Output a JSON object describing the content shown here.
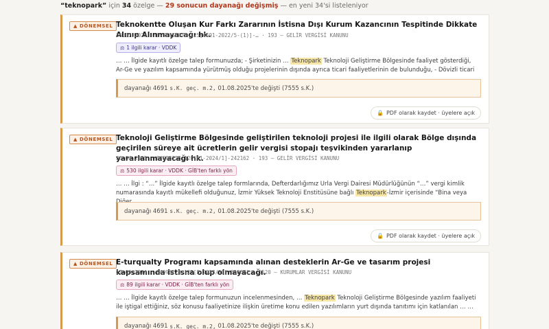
{
  "summary": {
    "query": "“teknopark”",
    "in_word": "için",
    "ruling_count": "34",
    "ruling_word": "özelge —",
    "changed_text": "29 sonucun dayanağı değişmiş",
    "tail": "— en yeni 34'si listeleniyor"
  },
  "results": [
    {
      "badge": "▲ DÖNEMSEL",
      "title": "Teknokentte Oluşan Kur Farkı Zararının İstisna Dışı Kurum Kazancının Tespitinde Dikkate Alınıp Alınmayacağı hk.",
      "meta": "30.07.2025 · E-38418978-125[4691-2022/5-(1)]-… · 193 — GELİR VERGİSİ KANUNU",
      "pill": "1 ilgili karar · VDDK",
      "pill_icon": "⚖",
      "excerpt_pre": "… … İlgide kayıtlı özelge talep formunuzda; - Şirketinizin … ",
      "excerpt_hl": "Teknopark",
      "excerpt_post": " Teknoloji Geliştirme Bölgesinde faaliyet gösterdiği, Ar-Ge ve yazılım kapsamında yürütmüş olduğu projelerinin dışında ayrıca ticari faaliyetlerinin de bulunduğu, - Dövizli ticari … …",
      "change_pre": "dayanağı 4691",
      "change_code": "s.K. geç. m.2,",
      "change_post": "01.08.2025'te değişti (7555 s.K.)",
      "pdf": "PDF olarak kaydet · üyelere açık",
      "pdf_icon": "🔒"
    },
    {
      "badge": "▲ DÖNEMSEL",
      "title": "Teknoloji Geliştirme Bölgesinde geliştirilen teknoloji projesi ile ilgili olarak Bölge dışında geçirilen süreye ait ücretlerin gelir vergisi stopajı teşvikinden yararlanıp yararlanmayacağı hk.",
      "meta": "30.04.2025 · 84098128-120[61-2024/1]-242162 · 193 — GELİR VERGİSİ KANUNU",
      "pill": "530 ilgili karar · VDDK · GİB'ten farklı yön",
      "pill_icon": "⚖",
      "excerpt_pre": "… … İlgi : “…” İlgide kayıtlı özelge talep formlarında, Defterdarlığımız Urla Vergi Dairesi Müdürlüğünün “…” vergi kimlik numarasında kayıtlı mükellefi olduğunuz, İzmir Yüksek Teknoloji Enstitüsüne bağlı ",
      "excerpt_hl": "Teknopark",
      "excerpt_post": "-İzmir içerisinde “Bina veya Diğer … …",
      "change_pre": "dayanağı 4691",
      "change_code": "s.K. geç. m.2,",
      "change_post": "01.08.2025'te değişti (7555 s.K.)",
      "pdf": "PDF olarak kaydet · üyelere açık",
      "pdf_icon": "🔒"
    },
    {
      "badge": "▲ DÖNEMSEL",
      "title": "E-turqualty Programı kapsamında alınan desteklerin Ar-Ge ve tasarım projesi kapsamında istisna olup olmayacağı.",
      "meta": "17.09.2024 · 84098128-125[5-2023/20]-550671 · 5520 — KURUMLAR VERGİSİ KANUNU",
      "pill": "89 ilgili karar · VDDK · GİB'ten farklı yön",
      "pill_icon": "⚖",
      "excerpt_pre": "… … İlgide kayıtlı özelge talep formunuzun incelenmesinden, … ",
      "excerpt_hl": "Teknopark",
      "excerpt_post": " Teknoloji Geliştirme Bölgesinde yazılım faaliyeti ile iştigal ettiğiniz, söz konusu faaliyetinize ilişkin üretime konu edilen yazılımların yurt dışında tanıtımı için katlanılan … …",
      "change_pre": "dayanağı 4691",
      "change_code": "s.K. geç. m.2,",
      "change_post": "01.08.2025'te değişti (7555 s.K.)",
      "pdf": "",
      "pdf_icon": ""
    }
  ]
}
